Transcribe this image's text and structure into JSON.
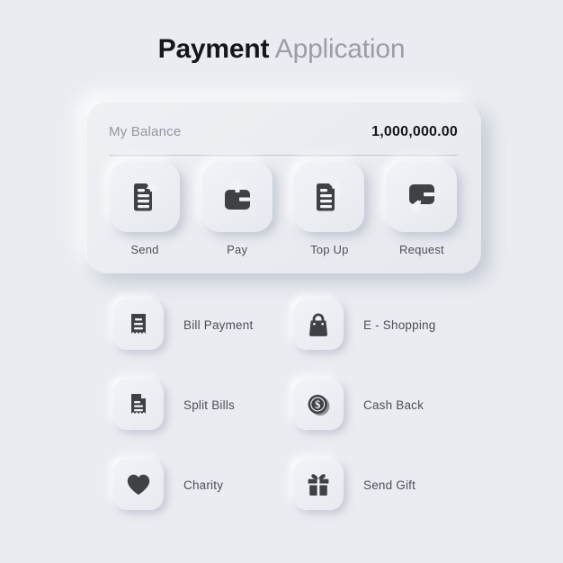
{
  "header": {
    "title_strong": "Payment",
    "title_light": "Application"
  },
  "balance": {
    "label": "My Balance",
    "amount": "1,000,000.00"
  },
  "actions": [
    {
      "label": "Send",
      "icon": "document-send-icon"
    },
    {
      "label": "Pay",
      "icon": "wallet-up-arrow-icon"
    },
    {
      "label": "Top Up",
      "icon": "document-up-arrow-icon"
    },
    {
      "label": "Request",
      "icon": "wallet-down-arrow-icon"
    }
  ],
  "menu": [
    {
      "label": "Bill Payment",
      "icon": "receipt-icon"
    },
    {
      "label": "E - Shopping",
      "icon": "handbag-icon"
    },
    {
      "label": "Split Bills",
      "icon": "split-receipt-icon"
    },
    {
      "label": "Cash Back",
      "icon": "dollar-coin-icon"
    },
    {
      "label": "Charity",
      "icon": "heart-icon"
    },
    {
      "label": "Send Gift",
      "icon": "gift-box-icon"
    }
  ],
  "colors": {
    "background": "#eaecf1",
    "icon_dark": "#3f4245",
    "text_primary": "#15171b",
    "text_secondary": "#4c5058",
    "text_muted": "#93979f"
  }
}
